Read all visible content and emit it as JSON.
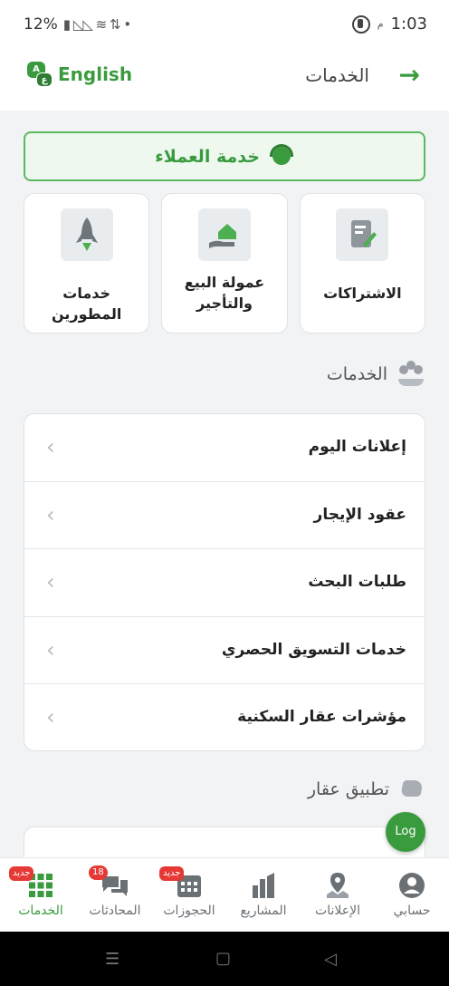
{
  "status_bar": {
    "battery": "12%",
    "time": "1:03",
    "period": "م"
  },
  "header": {
    "title": "الخدمات",
    "language_label": "English",
    "lang_icon_a": "A",
    "lang_icon_b": "ع"
  },
  "customer_service": {
    "label": "خدمة العملاء"
  },
  "cards": [
    {
      "label": "الاشتراكات",
      "icon": "subscription-scroll-icon"
    },
    {
      "label": "عمولة البيع والتأجير",
      "icon": "house-in-hand-icon"
    },
    {
      "label": "خدمات المطورين",
      "icon": "rocket-icon"
    }
  ],
  "services_section": {
    "title": "الخدمات",
    "items": [
      {
        "label": "إعلانات اليوم"
      },
      {
        "label": "عقود الإيجار"
      },
      {
        "label": "طلبات البحث"
      },
      {
        "label": "خدمات التسويق الحصري"
      },
      {
        "label": "مؤشرات عقار السكنية"
      }
    ]
  },
  "aqar_section": {
    "title": "تطبيق عقار"
  },
  "fab": {
    "label": "Log"
  },
  "bottom_nav": {
    "items": [
      {
        "label": "حسابي",
        "icon": "account-icon"
      },
      {
        "label": "الإعلانات",
        "icon": "map-pin-icon"
      },
      {
        "label": "المشاريع",
        "icon": "buildings-icon"
      },
      {
        "label": "الحجوزات",
        "icon": "calendar-icon",
        "badge": "جديد"
      },
      {
        "label": "المحادثات",
        "icon": "chat-icon",
        "badge": "18"
      },
      {
        "label": "الخدمات",
        "icon": "grid-icon",
        "badge": "جديد",
        "active": true
      }
    ]
  },
  "colors": {
    "accent": "#3a9b3e",
    "badge": "#e53935",
    "background": "#f2f3f5"
  }
}
